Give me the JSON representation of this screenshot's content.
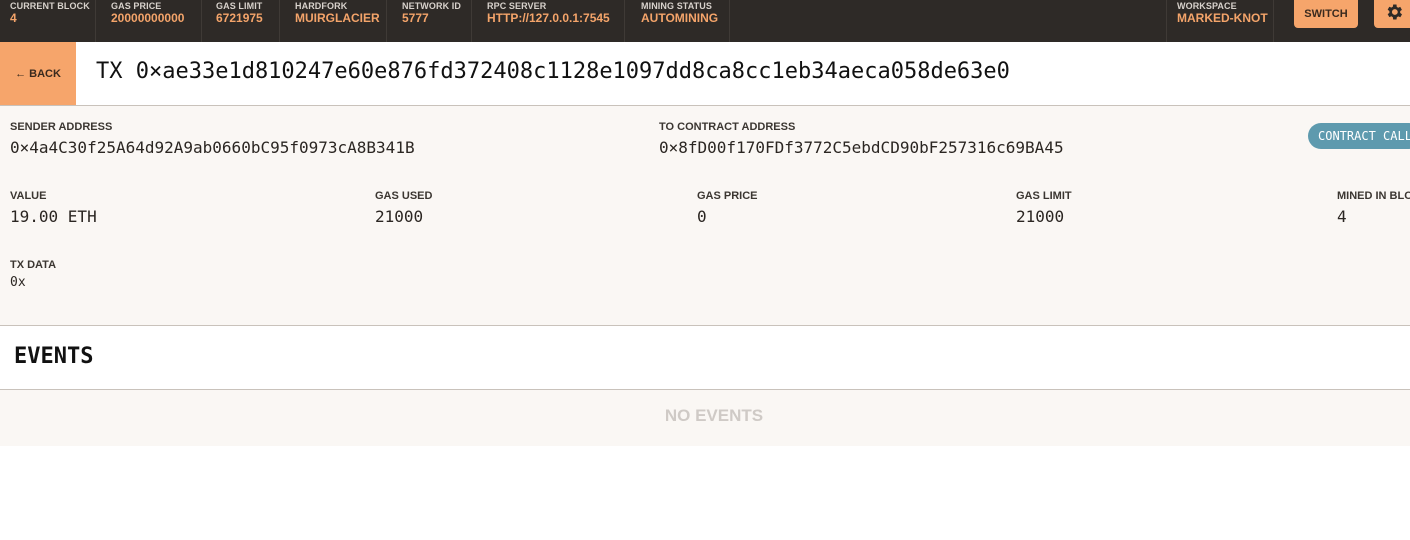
{
  "topbar": {
    "stats": [
      {
        "label": "CURRENT BLOCK",
        "value": "4"
      },
      {
        "label": "GAS PRICE",
        "value": "20000000000"
      },
      {
        "label": "GAS LIMIT",
        "value": "6721975"
      },
      {
        "label": "HARDFORK",
        "value": "MUIRGLACIER"
      },
      {
        "label": "NETWORK ID",
        "value": "5777"
      },
      {
        "label": "RPC SERVER",
        "value": "HTTP://127.0.0.1:7545"
      },
      {
        "label": "MINING STATUS",
        "value": "AUTOMINING"
      }
    ],
    "workspace": {
      "label": "WORKSPACE",
      "value": "MARKED-KNOT"
    },
    "switch_label": "SWITCH",
    "settings_icon": "gear-icon"
  },
  "title": {
    "back_label": "← BACK",
    "tx_title": "TX 0×ae33e1d810247e60e876fd372408c1128e1097dd8ca8cc1eb34aeca058de63e0"
  },
  "details": {
    "sender_label": "SENDER ADDRESS",
    "sender_value": "0×4a4C30f25A64d92A9ab0660bC95f0973cA8B341B",
    "to_label": "TO CONTRACT ADDRESS",
    "to_value": "0×8fD00f170FDf3772C5ebdCD90bF257316c69BA45",
    "badge": "CONTRACT CALL",
    "value_label": "VALUE",
    "value_value": "19.00 ETH",
    "gas_used_label": "GAS USED",
    "gas_used_value": "21000",
    "gas_price_label": "GAS PRICE",
    "gas_price_value": "0",
    "gas_limit_label": "GAS LIMIT",
    "gas_limit_value": "21000",
    "mined_label": "MINED IN BLOCK",
    "mined_value": "4",
    "txdata_label": "TX DATA",
    "txdata_value": "0x"
  },
  "events": {
    "title": "EVENTS",
    "empty": "NO EVENTS"
  }
}
